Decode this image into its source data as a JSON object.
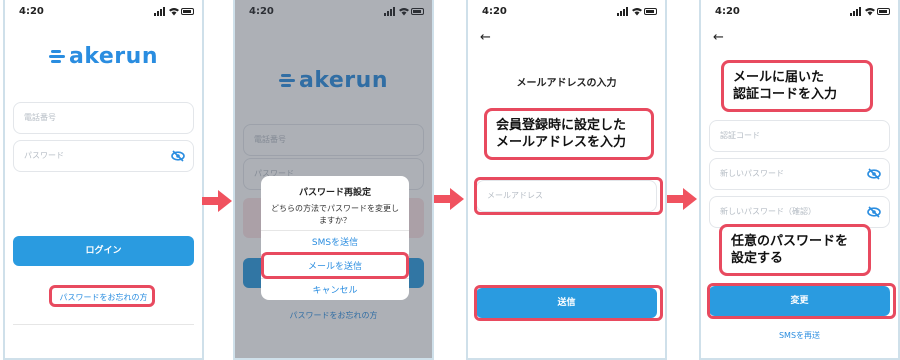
{
  "status": {
    "time": "4:20"
  },
  "screen1": {
    "logo": "akerun",
    "phone_placeholder": "電話番号",
    "password_placeholder": "パスワード",
    "login_label": "ログイン",
    "forgot_label": "パスワードをお忘れの方"
  },
  "screen2": {
    "logo": "akerun",
    "phone_placeholder": "電話番号",
    "password_placeholder": "パスワード",
    "dialog_title": "パスワード再設定",
    "dialog_message": "どちらの方法でパスワードを変更しますか？",
    "option_sms": "SMSを送信",
    "option_mail": "メールを送信",
    "option_cancel": "キャンセル",
    "forgot_label": "パスワードをお忘れの方"
  },
  "screen3": {
    "back_icon": "←",
    "title": "メールアドレスの入力",
    "callout": "会員登録時に設定した\nメールアドレスを入力",
    "email_placeholder": "メールアドレス",
    "send_label": "送信"
  },
  "screen4": {
    "back_icon": "←",
    "callout_top": "メールに届いた\n認証コードを入力",
    "code_placeholder": "認証コード",
    "new_password_placeholder": "新しいパスワード",
    "confirm_password_placeholder": "新しいパスワード（確認）",
    "callout_bottom": "任意のパスワードを\n設定する",
    "change_label": "変更",
    "resend_label": "SMSを再送"
  },
  "colors": {
    "accent": "#2a9be0",
    "highlight": "#e84a5f",
    "arrow": "#f0525f"
  }
}
